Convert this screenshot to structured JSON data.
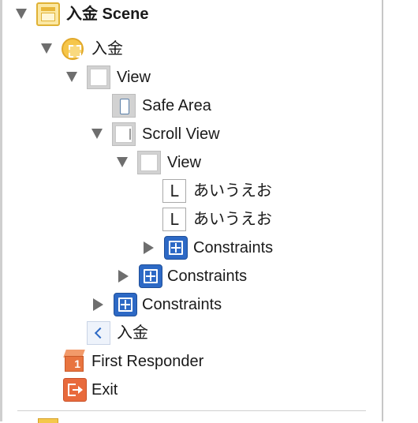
{
  "outline": {
    "scene_label": "入金 Scene",
    "view_controller_label": "入金",
    "view_label": "View",
    "safe_area_label": "Safe Area",
    "scroll_view_label": "Scroll View",
    "content_view_label": "View",
    "label1_text": "あいうえお",
    "label2_text": "あいうえお",
    "label_icon_glyph": "L",
    "content_constraints_label": "Constraints",
    "scroll_constraints_label": "Constraints",
    "view_constraints_label": "Constraints",
    "back_item_label": "入金",
    "first_responder_label": "First Responder",
    "first_responder_badge": "1",
    "exit_label": "Exit"
  }
}
